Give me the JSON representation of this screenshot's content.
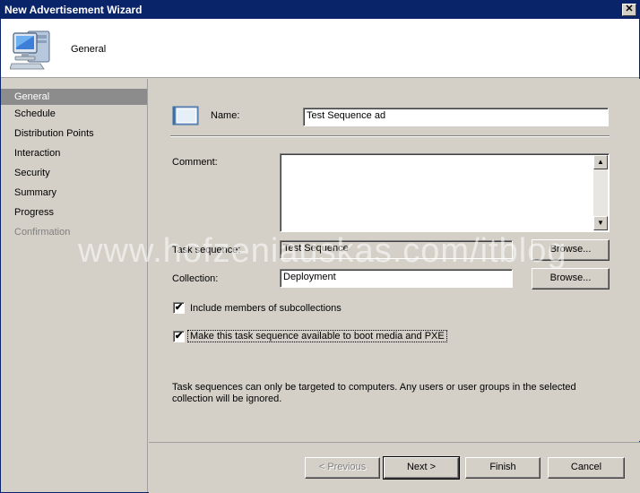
{
  "window": {
    "title": "New Advertisement Wizard",
    "close_glyph": "✕"
  },
  "header": {
    "title": "General",
    "icon": "computer-icon"
  },
  "sidebar": {
    "items": [
      {
        "label": "General",
        "state": "active"
      },
      {
        "label": "Schedule",
        "state": "normal"
      },
      {
        "label": "Distribution Points",
        "state": "normal"
      },
      {
        "label": "Interaction",
        "state": "normal"
      },
      {
        "label": "Security",
        "state": "normal"
      },
      {
        "label": "Summary",
        "state": "normal"
      },
      {
        "label": "Progress",
        "state": "normal"
      },
      {
        "label": "Confirmation",
        "state": "disabled"
      }
    ]
  },
  "form": {
    "name_label": "Name:",
    "name_value": "Test Sequence ad",
    "comment_label": "Comment:",
    "comment_value": "",
    "task_sequence_label": "Task sequence:",
    "task_sequence_value": "Test Sequence",
    "collection_label": "Collection:",
    "collection_value": "Deployment",
    "browse_label": "Browse...",
    "include_subcollections_label": "Include members of subcollections",
    "include_subcollections_checked": true,
    "boot_media_label": "Make this task sequence available to boot media and PXE",
    "boot_media_checked": true,
    "note": "Task sequences can only be targeted to computers.  Any users or user groups in the selected collection will be ignored."
  },
  "watermark": "www.hofzeniauskas.com/itblog",
  "footer": {
    "previous_label": "< Previous",
    "next_label": "Next >",
    "finish_label": "Finish",
    "cancel_label": "Cancel"
  },
  "checkmark": "✔"
}
